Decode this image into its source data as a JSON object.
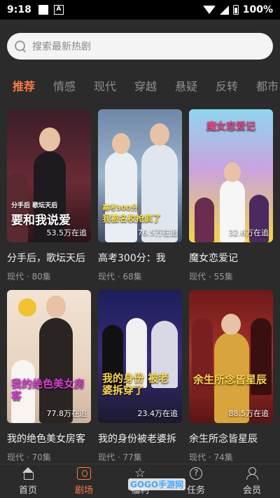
{
  "status": {
    "time": "9:18",
    "battery": "100%"
  },
  "search": {
    "placeholder": "搜索最新热剧"
  },
  "tabs": [
    "推荐",
    "情感",
    "现代",
    "穿越",
    "悬疑",
    "反转",
    "都市"
  ],
  "dramas": [
    {
      "title": "分手后，歌坛天后",
      "meta": "现代 · 80集",
      "poster_title": "要和我说爱",
      "poster_sub": "分手后 歌坛天后",
      "badge": "53.5万在追"
    },
    {
      "title": "高考300分：我",
      "meta": "现代 · 68集",
      "poster_title": "我被名校抢疯了",
      "poster_sub": "高考300分",
      "badge": "76.5万在追"
    },
    {
      "title": "魔女恋爱记",
      "meta": "现代 · 55集",
      "poster_title": "魔女恋爱记",
      "poster_sub": "",
      "badge": "32.6万在追"
    },
    {
      "title": "我的绝色美女房客",
      "meta": "现代 · 70集",
      "poster_title": "我的绝色美女房客",
      "poster_sub": "",
      "badge": "77.8万在追"
    },
    {
      "title": "我的身份被老婆拆",
      "meta": "现代 · 77集",
      "poster_title": "我的身份 被老婆拆穿了",
      "poster_sub": "",
      "badge": "23.4万在追"
    },
    {
      "title": "余生所念皆星辰",
      "meta": "现代 · 74集",
      "poster_title": "余生所念皆星辰",
      "poster_sub": "",
      "badge": "88.5万在追"
    }
  ],
  "nav": [
    "首页",
    "剧场",
    "福利",
    "任务",
    "会员"
  ],
  "watermark": "GOGO手游网",
  "colors": {
    "accent": "#ff7a45",
    "background": "#2b2b2b"
  }
}
